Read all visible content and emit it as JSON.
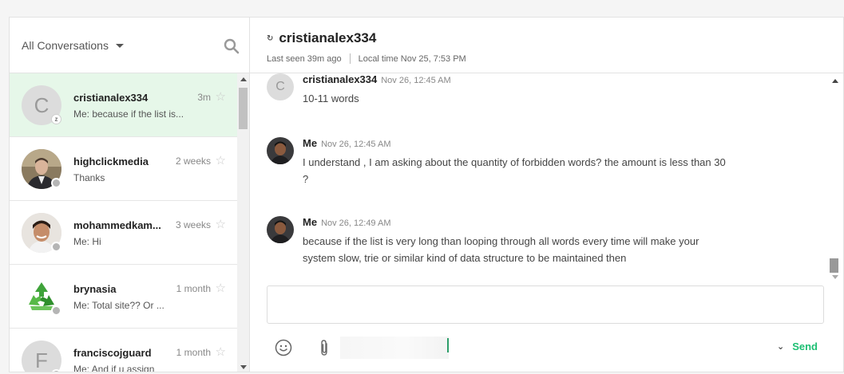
{
  "sidebar": {
    "filter_label": "All Conversations",
    "conversations": [
      {
        "name": "cristianalex334",
        "time": "3m",
        "preview": "Me: because if the list is...",
        "initial": "C"
      },
      {
        "name": "highclickmedia",
        "time": "2 weeks",
        "preview": "Thanks"
      },
      {
        "name": "mohammedkam...",
        "time": "3 weeks",
        "preview": "Me: Hi"
      },
      {
        "name": "brynasia",
        "time": "1 month",
        "preview": "Me: Total site?? Or ..."
      },
      {
        "name": "franciscojguard",
        "time": "1 month",
        "preview": "Me: And if u assign",
        "initial": "F"
      }
    ]
  },
  "chat": {
    "title": "cristianalex334",
    "last_seen": "Last seen 39m ago",
    "local_time": "Local time Nov 25, 7:53 PM",
    "messages": [
      {
        "sender": "cristianalex334",
        "time": "Nov 26, 12:45 AM",
        "text": "10-11 words",
        "initial": "C"
      },
      {
        "sender": "Me",
        "time": "Nov 26, 12:45 AM",
        "text": "I understand , I am asking about the quantity of forbidden words? the amount is less than 30 ?"
      },
      {
        "sender": "Me",
        "time": "Nov 26, 12:49 AM",
        "text": "because if the list is very long than looping through all words every time will make your system slow, trie or similar kind of data structure to be maintained then"
      }
    ],
    "composer_placeholder": "",
    "send_label": "Send"
  },
  "colors": {
    "accent_green": "#1dbf73",
    "active_row": "#e6f7e9"
  }
}
